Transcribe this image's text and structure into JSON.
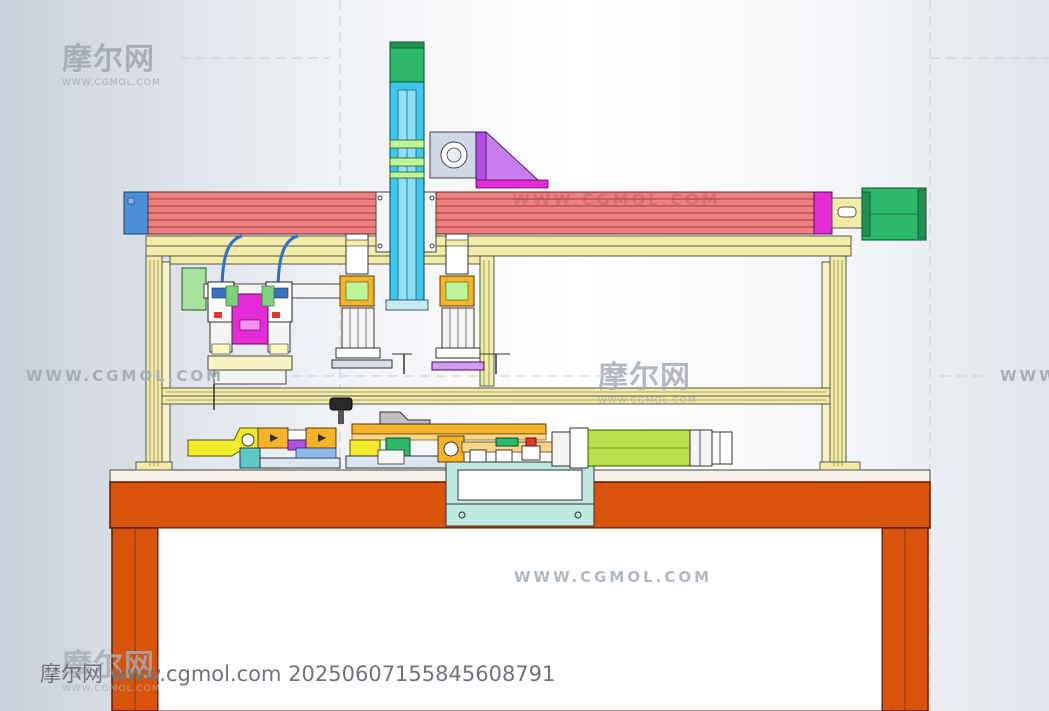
{
  "watermarks": {
    "logo_text": "摩尔网",
    "logo_sub": "WWW.CGMOL.COM",
    "url_text": "WWW.CGMOL.COM"
  },
  "footer": {
    "text": "摩尔网 www.cgmol.com 20250607155845608791"
  },
  "colors": {
    "table_frame": "#d9530a",
    "table_outline": "#6b2200",
    "gantry_beam": "#ee7f80",
    "aluminum_frame": "#f2eda6",
    "z_axis": "#3ec8ee",
    "servo_motor": "#2db96b",
    "magenta_part": "#e52ad7",
    "cylinder": "#b8e04a",
    "bracket_purple": "#b24fe0",
    "fixture_orange": "#f5b32a",
    "fixture_yellow": "#f2ea2a",
    "gauge_blue": "#4b8fd8"
  }
}
